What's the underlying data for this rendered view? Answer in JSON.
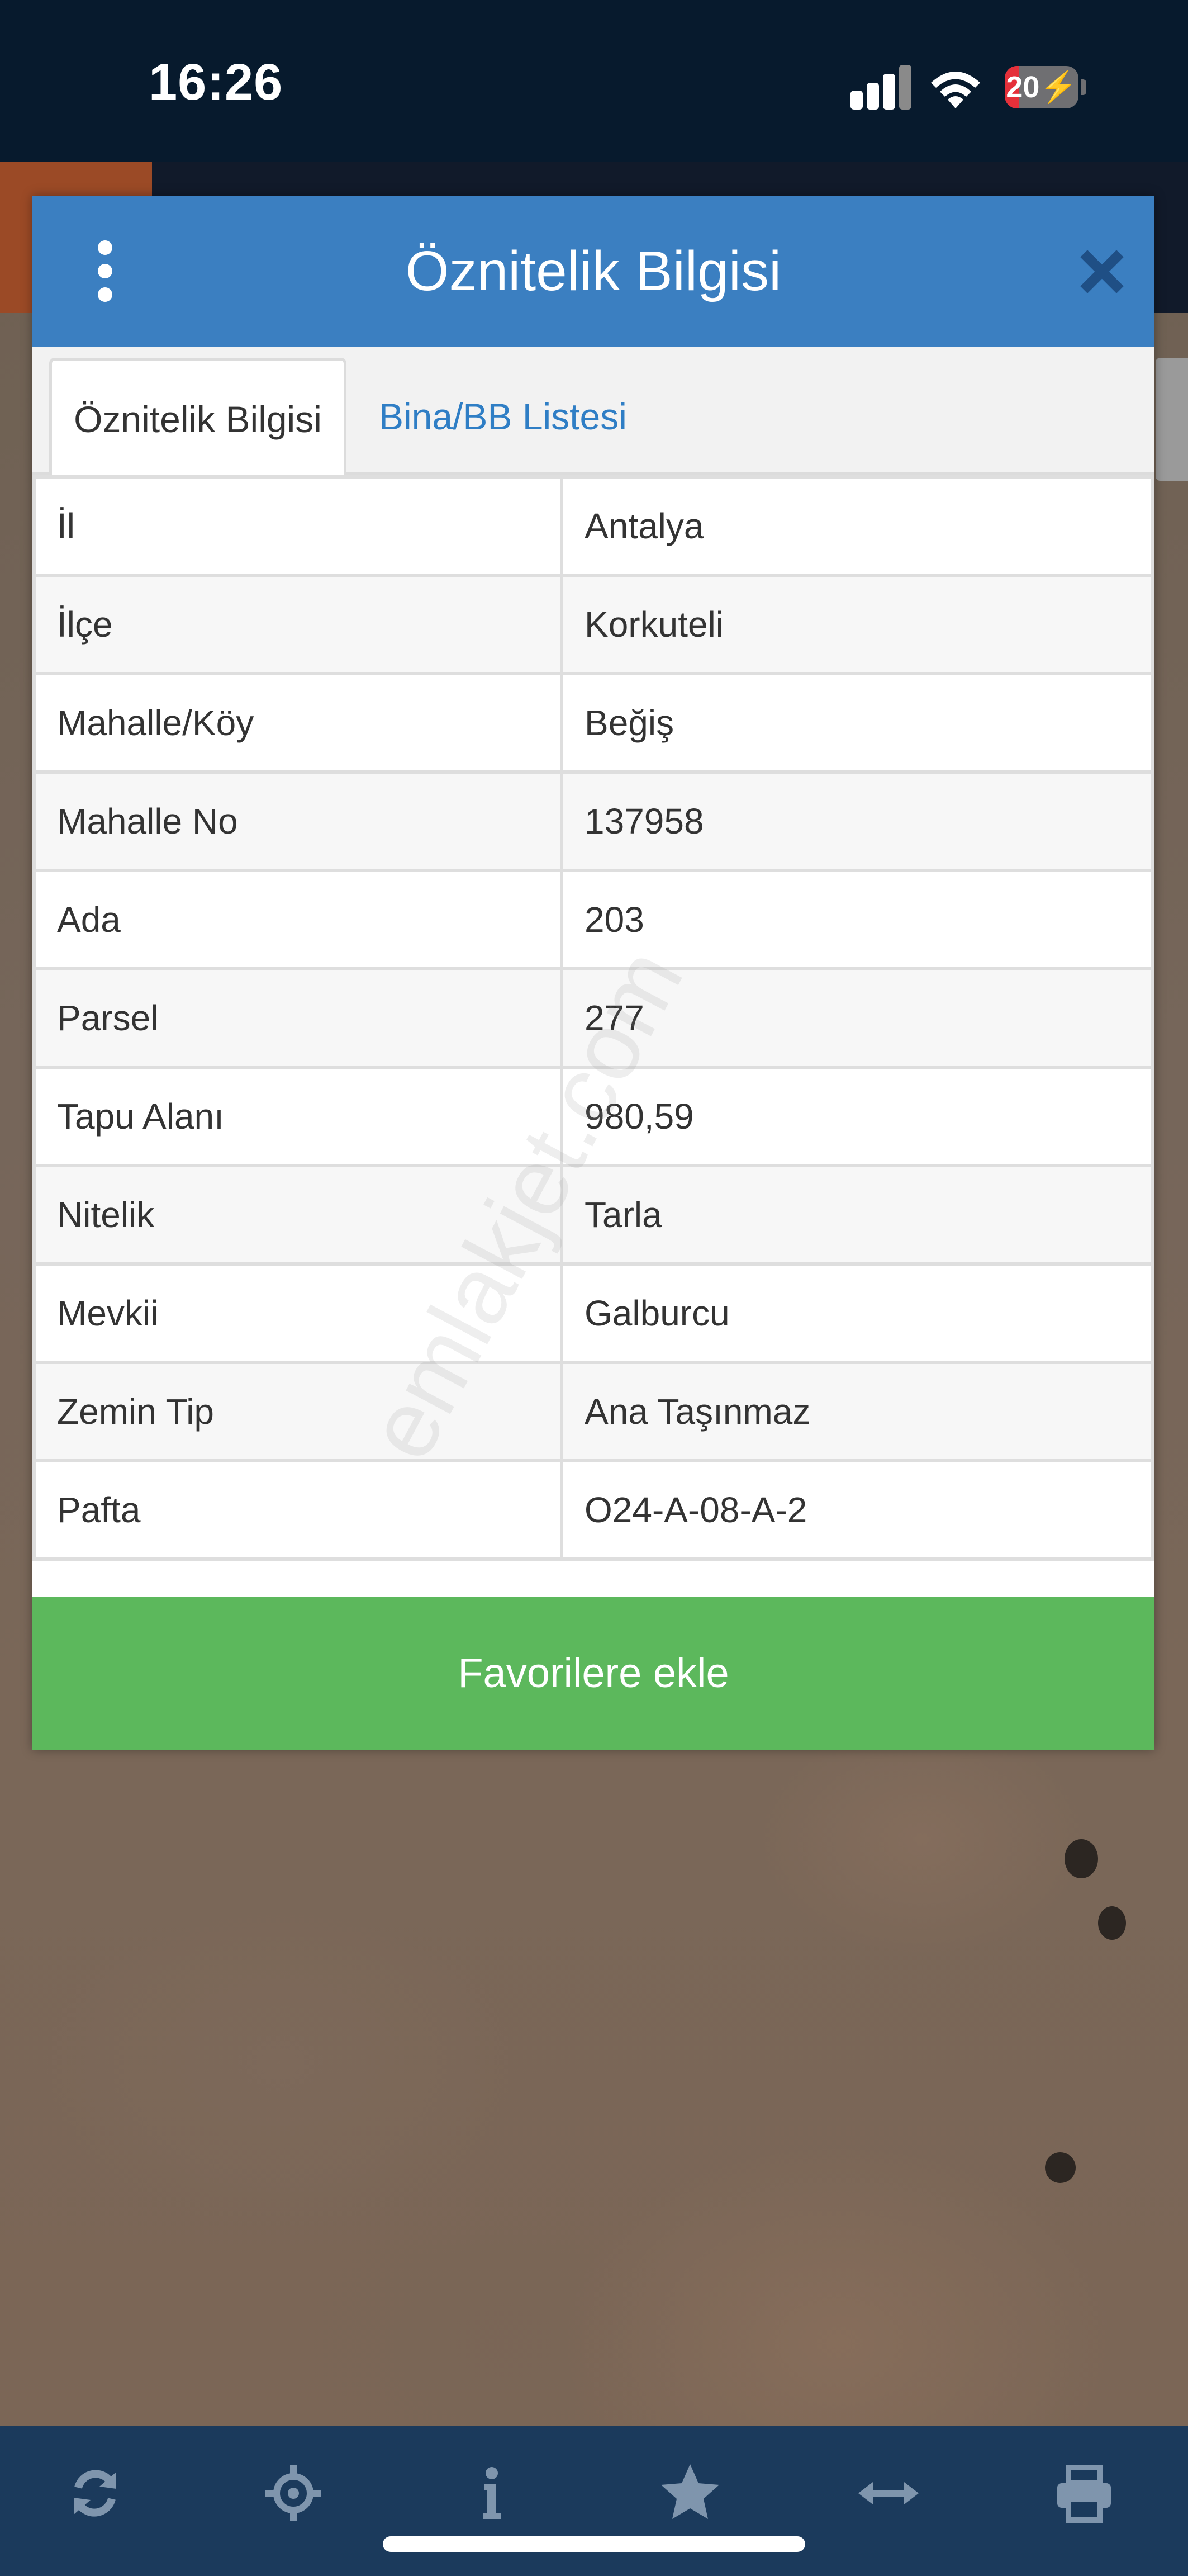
{
  "status_bar": {
    "time": "16:26",
    "battery_level": "20",
    "battery_percent": 20
  },
  "dialog": {
    "title": "Öznitelik Bilgisi",
    "tabs": [
      {
        "label": "Öznitelik Bilgisi",
        "active": true
      },
      {
        "label": "Bina/BB Listesi",
        "active": false
      }
    ],
    "rows": [
      {
        "key": "İl",
        "value": "Antalya"
      },
      {
        "key": "İlçe",
        "value": "Korkuteli"
      },
      {
        "key": "Mahalle/Köy",
        "value": "Beğiş"
      },
      {
        "key": "Mahalle No",
        "value": "137958"
      },
      {
        "key": "Ada",
        "value": "203"
      },
      {
        "key": "Parsel",
        "value": "277"
      },
      {
        "key": "Tapu Alanı",
        "value": "980,59"
      },
      {
        "key": "Nitelik",
        "value": "Tarla"
      },
      {
        "key": "Mevkii",
        "value": "Galburcu"
      },
      {
        "key": "Zemin Tip",
        "value": "Ana Taşınmaz"
      },
      {
        "key": "Pafta",
        "value": "O24-A-08-A-2"
      }
    ],
    "favorite_button_label": "Favorilere ekle"
  },
  "watermark": "emlakjet.com",
  "toolbar": {
    "icons": [
      "refresh-icon",
      "locate-icon",
      "info-icon",
      "star-icon",
      "measure-icon",
      "print-icon"
    ]
  },
  "colors": {
    "header": "#3b7fc1",
    "favorite_button": "#5cb85c",
    "toolbar": "#1b3a5c",
    "status_bar": "#071a2d",
    "tab_link": "#2f7ec5"
  }
}
